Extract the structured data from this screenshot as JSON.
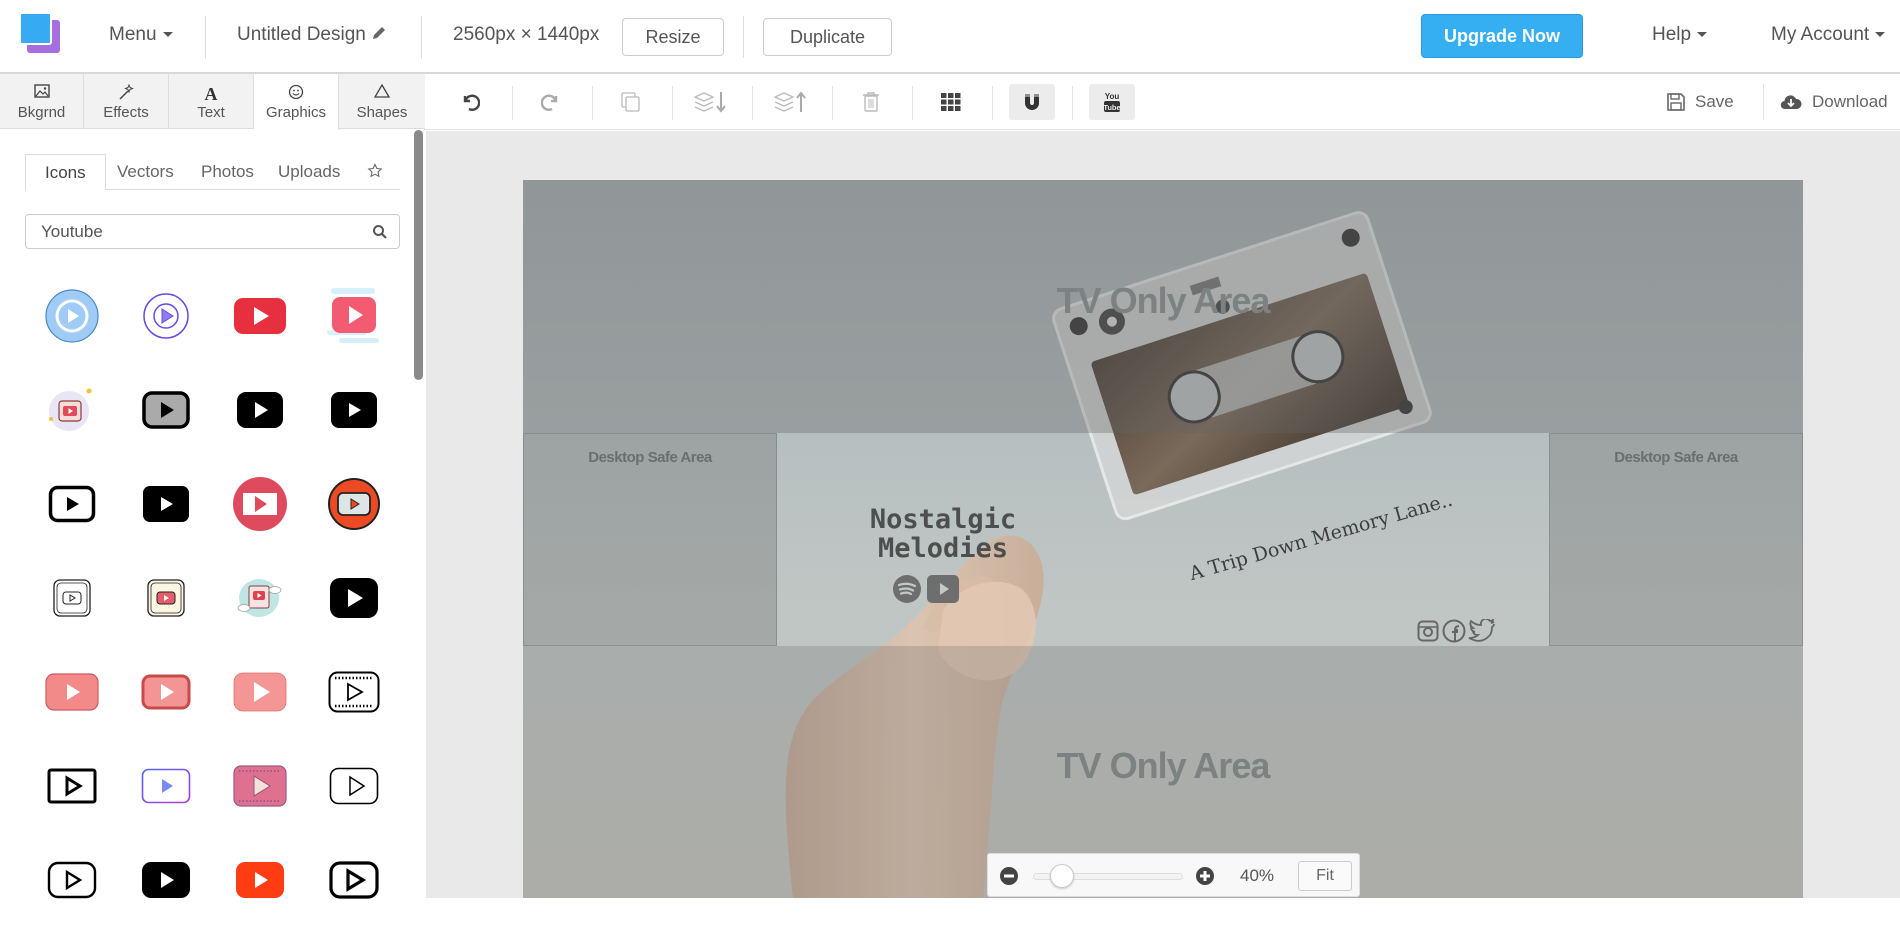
{
  "header": {
    "menu_label": "Menu",
    "design_title": "Untitled Design",
    "dimensions": "2560px × 1440px",
    "resize_label": "Resize",
    "duplicate_label": "Duplicate",
    "upgrade_label": "Upgrade Now",
    "help_label": "Help",
    "account_label": "My Account",
    "brand_color": "#36aef2"
  },
  "toolbar": {
    "tools": [
      "undo-icon",
      "redo-icon",
      "copy-icon",
      "send-backward-icon",
      "bring-forward-icon",
      "delete-icon",
      "grid-icon",
      "magnet-icon",
      "youtube-icon"
    ],
    "save_label": "Save",
    "download_label": "Download"
  },
  "sidebar": {
    "categories": [
      {
        "label": "Bkgrnd",
        "icon": "image-icon"
      },
      {
        "label": "Effects",
        "icon": "magic-wand-icon"
      },
      {
        "label": "Text",
        "icon": "text-icon"
      },
      {
        "label": "Graphics",
        "icon": "smiley-icon",
        "active": true
      },
      {
        "label": "Shapes",
        "icon": "triangle-icon"
      }
    ],
    "subtabs": [
      "Icons",
      "Vectors",
      "Photos",
      "Uploads"
    ],
    "active_subtab": "Icons",
    "search": {
      "value": "Youtube",
      "placeholder": "Search"
    },
    "icon_results": [
      "blue-circle-play",
      "purple-circle-play",
      "red-youtube",
      "pink-gradient-youtube",
      "sticker-youtube",
      "gray-youtube-outline",
      "black-youtube",
      "black-youtube-small",
      "black-outline-youtube",
      "black-filled-youtube",
      "red-circle-youtube",
      "orange-circle-youtube",
      "thin-outline-youtube",
      "cream-youtube",
      "cloud-youtube",
      "black-youtube-large",
      "pink-youtube",
      "pink-youtube-border",
      "light-pink-youtube",
      "film-youtube",
      "square-outline-play",
      "gradient-outline-youtube",
      "pink-film-youtube",
      "dotted-outline-youtube",
      "rounded-outline-youtube",
      "black-youtube-2",
      "orange-youtube",
      "bold-outline-youtube"
    ]
  },
  "canvas": {
    "tv_top_label": "TV Only Area",
    "tv_bottom_label": "TV Only Area",
    "desktop_left_label": "Desktop Safe Area",
    "desktop_right_label": "Desktop Safe Area",
    "title_line1": "Nostalgic",
    "title_line2": "Melodies",
    "tagline": "A Trip Down Memory Lane.."
  },
  "zoom": {
    "percent_label": "40%",
    "value": 40,
    "fit_label": "Fit"
  }
}
